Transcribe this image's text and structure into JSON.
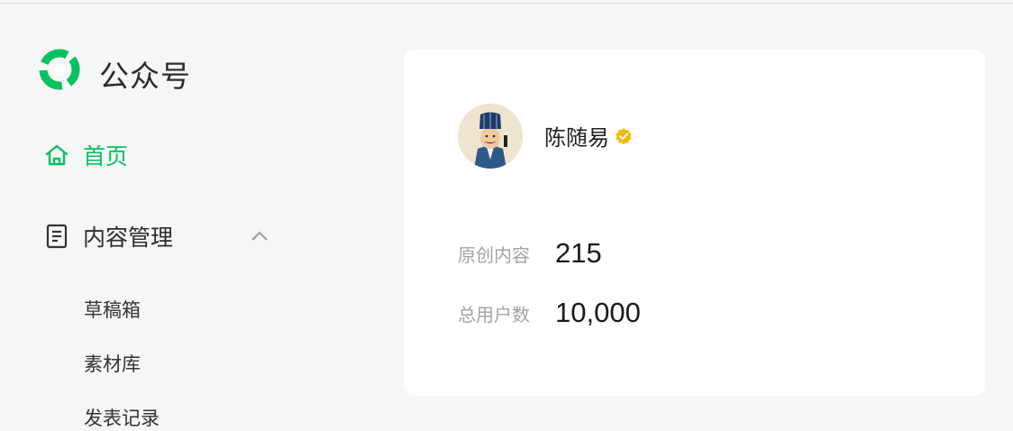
{
  "sidebar": {
    "brand": "公众号",
    "nav": {
      "home": {
        "label": "首页",
        "icon": "home-icon",
        "active": true
      },
      "content": {
        "label": "内容管理",
        "icon": "document-icon",
        "expanded": true,
        "chevron": "chevron-up-icon"
      }
    },
    "content_items": [
      {
        "label": "草稿箱"
      },
      {
        "label": "素材库"
      },
      {
        "label": "发表记录"
      }
    ]
  },
  "account": {
    "name": "陈随易",
    "verified": true,
    "stats": [
      {
        "label": "原创内容",
        "value": "215"
      },
      {
        "label": "总用户数",
        "value": "10,000"
      }
    ]
  },
  "colors": {
    "accent": "#07c160",
    "verified_badge": "#f5b800",
    "background": "#f5f6f7"
  }
}
